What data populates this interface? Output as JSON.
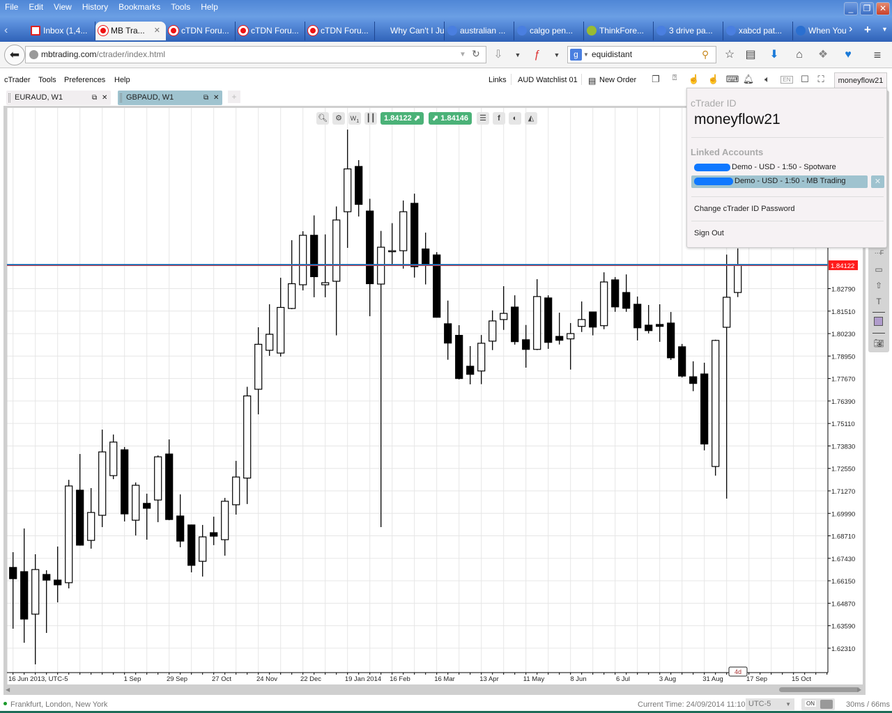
{
  "browser": {
    "menu": [
      "File",
      "Edit",
      "View",
      "History",
      "Bookmarks",
      "Tools",
      "Help"
    ],
    "tabs": [
      {
        "label": "Inbox (1,4...",
        "icon": "gmail-icon",
        "badge": "1"
      },
      {
        "label": "MB Tra...",
        "icon": "ctrader-icon",
        "active": true
      },
      {
        "label": "cTDN Foru...",
        "icon": "ctrader-icon"
      },
      {
        "label": "cTDN Foru...",
        "icon": "ctrader-icon"
      },
      {
        "label": "cTDN Foru...",
        "icon": "ctrader-icon"
      },
      {
        "label": "Why Can't I Ju...",
        "icon": "none"
      },
      {
        "label": "australian ...",
        "icon": "google-icon"
      },
      {
        "label": "calgo pen...",
        "icon": "google-icon"
      },
      {
        "label": "ThinkFore...",
        "icon": "thinkforex-icon"
      },
      {
        "label": "3 drive pa...",
        "icon": "google-icon"
      },
      {
        "label": "xabcd pat...",
        "icon": "google-icon"
      },
      {
        "label": "When You",
        "icon": "icn-icon"
      }
    ],
    "url_host": "mbtrading.com",
    "url_path": "/ctrader/index.html",
    "search_value": "equidistant"
  },
  "app": {
    "menu": [
      "cTrader",
      "Tools",
      "Preferences",
      "Help"
    ],
    "links_label": "Links",
    "watchlist_label": "AUD Watchlist 01",
    "new_order_label": "New Order",
    "account_button": "moneyflow21",
    "chart_tabs": [
      {
        "label": "EURAUD, W1",
        "active": false
      },
      {
        "label": "GBPAUD, W1",
        "active": true
      }
    ],
    "add_tab": "+"
  },
  "chart_toolbar": {
    "timeframe": "W",
    "timeframe_sub": "1",
    "sell_price": "1.84122",
    "buy_price": "1.84146"
  },
  "account_menu": {
    "section_title": "cTrader ID",
    "username": "moneyflow21",
    "linked_title": "Linked Accounts",
    "accounts": [
      {
        "label": "Demo - USD - 1:50 - Spotware",
        "selected": false
      },
      {
        "label": "Demo - USD - 1:50 - MB Trading",
        "selected": true
      }
    ],
    "change_password": "Change cTrader ID Password",
    "sign_out": "Sign Out"
  },
  "status": {
    "sessions": "Frankfurt, London, New York",
    "current_time": "Current Time: 24/09/2014 11:10",
    "timezone": "UTC-5",
    "toggle": "ON",
    "latency": "30ms / 66ms"
  },
  "chart_data": {
    "type": "candlestick",
    "symbol": "GBPAUD",
    "timeframe": "W1",
    "current_price": "1.84122",
    "period_marker": "4d",
    "grid": true,
    "colors": {
      "bull": "#ffffff",
      "bear": "#000000",
      "price_line": "#1f6fb5",
      "price_tag": "#ff1a1a"
    },
    "y_ticks": [
      "1.82790",
      "1.81510",
      "1.80230",
      "1.78950",
      "1.77670",
      "1.76390",
      "1.75110",
      "1.73830",
      "1.72550",
      "1.71270",
      "1.69990",
      "1.68710",
      "1.67430",
      "1.66150",
      "1.64870",
      "1.63590",
      "1.62310"
    ],
    "x_ticks": [
      "16 Jun 2013, UTC-5",
      "1 Sep",
      "29 Sep",
      "27 Oct",
      "24 Nov",
      "22 Dec",
      "19 Jan 2014",
      "16 Feb",
      "16 Mar",
      "13 Apr",
      "11 May",
      "8 Jun",
      "6 Jul",
      "3 Aug",
      "31 Aug",
      "17 Sep",
      "15 Oct"
    ],
    "ohlc": [
      [
        1.6691,
        1.6778,
        1.6342,
        1.6627
      ],
      [
        1.6667,
        1.6913,
        1.6262,
        1.6397
      ],
      [
        1.6425,
        1.6766,
        1.6139,
        1.6679
      ],
      [
        1.6651,
        1.6675,
        1.6318,
        1.6619
      ],
      [
        1.6619,
        1.681,
        1.6492,
        1.6592
      ],
      [
        1.6604,
        1.719,
        1.6572,
        1.7155
      ],
      [
        1.7131,
        1.7337,
        1.6815,
        1.6818
      ],
      [
        1.6845,
        1.7143,
        1.6798,
        1.7004
      ],
      [
        1.6988,
        1.7476,
        1.6921,
        1.7349
      ],
      [
        1.7214,
        1.7448,
        1.7194,
        1.7405
      ],
      [
        1.7361,
        1.7377,
        1.6953,
        1.6996
      ],
      [
        1.696,
        1.7175,
        1.6873,
        1.7159
      ],
      [
        1.7056,
        1.7111,
        1.6849,
        1.7028
      ],
      [
        1.7075,
        1.7329,
        1.6949,
        1.7321
      ],
      [
        1.7337,
        1.742,
        1.696,
        1.6964
      ],
      [
        1.6984,
        1.7107,
        1.6806,
        1.6841
      ],
      [
        1.6933,
        1.6935,
        1.6663,
        1.6703
      ],
      [
        1.6726,
        1.6933,
        1.6639,
        1.6865
      ],
      [
        1.6889,
        1.698,
        1.6818,
        1.6869
      ],
      [
        1.6849,
        1.7087,
        1.6758,
        1.7068
      ],
      [
        1.7048,
        1.7298,
        1.6992,
        1.7206
      ],
      [
        1.72,
        1.772,
        1.7052,
        1.7668
      ],
      [
        1.7706,
        1.8059,
        1.7563,
        1.7962
      ],
      [
        1.7928,
        1.819,
        1.7896,
        1.8019
      ],
      [
        1.7912,
        1.8341,
        1.7892,
        1.8172
      ],
      [
        1.8166,
        1.8555,
        1.8162,
        1.8307
      ],
      [
        1.8301,
        1.8606,
        1.8269,
        1.8583
      ],
      [
        1.8583,
        1.8696,
        1.823,
        1.8347
      ],
      [
        1.8301,
        1.8588,
        1.823,
        1.8313
      ],
      [
        1.8321,
        1.8747,
        1.8013,
        1.867
      ],
      [
        1.8717,
        1.9185,
        1.8511,
        1.8961
      ],
      [
        1.8975,
        1.9011,
        1.869,
        1.8759
      ],
      [
        1.8721,
        1.8791,
        1.8122,
        1.8307
      ],
      [
        1.8305,
        1.8608,
        1.6921,
        1.8515
      ],
      [
        1.8493,
        1.8652,
        1.8412,
        1.8495
      ],
      [
        1.8495,
        1.8781,
        1.8393,
        1.8717
      ],
      [
        1.8765,
        1.882,
        1.8342,
        1.8404
      ],
      [
        1.8505,
        1.8598,
        1.8303,
        1.8412
      ],
      [
        1.8471,
        1.8487,
        1.8114,
        1.8116
      ],
      [
        1.8079,
        1.8211,
        1.7874,
        1.7969
      ],
      [
        1.8013,
        1.8071,
        1.7762,
        1.7767
      ],
      [
        1.7837,
        1.7952,
        1.7734,
        1.7791
      ],
      [
        1.781,
        1.8015,
        1.7735,
        1.7968
      ],
      [
        1.798,
        1.8155,
        1.7929,
        1.8095
      ],
      [
        1.8103,
        1.8293,
        1.8044,
        1.8138
      ],
      [
        1.8174,
        1.8241,
        1.796,
        1.7977
      ],
      [
        1.7988,
        1.8072,
        1.7829,
        1.7933
      ],
      [
        1.7933,
        1.8333,
        1.7929,
        1.8234
      ],
      [
        1.8226,
        1.8241,
        1.7936,
        1.7973
      ],
      [
        1.8007,
        1.8142,
        1.7961,
        1.7985
      ],
      [
        1.7993,
        1.8083,
        1.7818,
        1.8023
      ],
      [
        1.8064,
        1.8206,
        1.8032,
        1.8103
      ],
      [
        1.8146,
        1.8148,
        1.8013,
        1.806
      ],
      [
        1.8068,
        1.8372,
        1.8048,
        1.8317
      ],
      [
        1.8329,
        1.8345,
        1.8147,
        1.8175
      ],
      [
        1.8257,
        1.836,
        1.8147,
        1.8167
      ],
      [
        1.819,
        1.8234,
        1.7984,
        1.8056
      ],
      [
        1.8071,
        1.8186,
        1.8024,
        1.804
      ],
      [
        1.8075,
        1.819,
        1.7976,
        1.8064
      ],
      [
        1.8083,
        1.8146,
        1.7873,
        1.7885
      ],
      [
        1.7948,
        1.7964,
        1.7773,
        1.7781
      ],
      [
        1.7777,
        1.7865,
        1.7695,
        1.7739
      ],
      [
        1.7793,
        1.7857,
        1.7358,
        1.7394
      ],
      [
        1.7266,
        1.7988,
        1.7214,
        1.7984
      ],
      [
        1.8059,
        1.8473,
        1.7083,
        1.823
      ],
      [
        1.8257,
        1.8508,
        1.8231,
        1.84122
      ]
    ]
  }
}
